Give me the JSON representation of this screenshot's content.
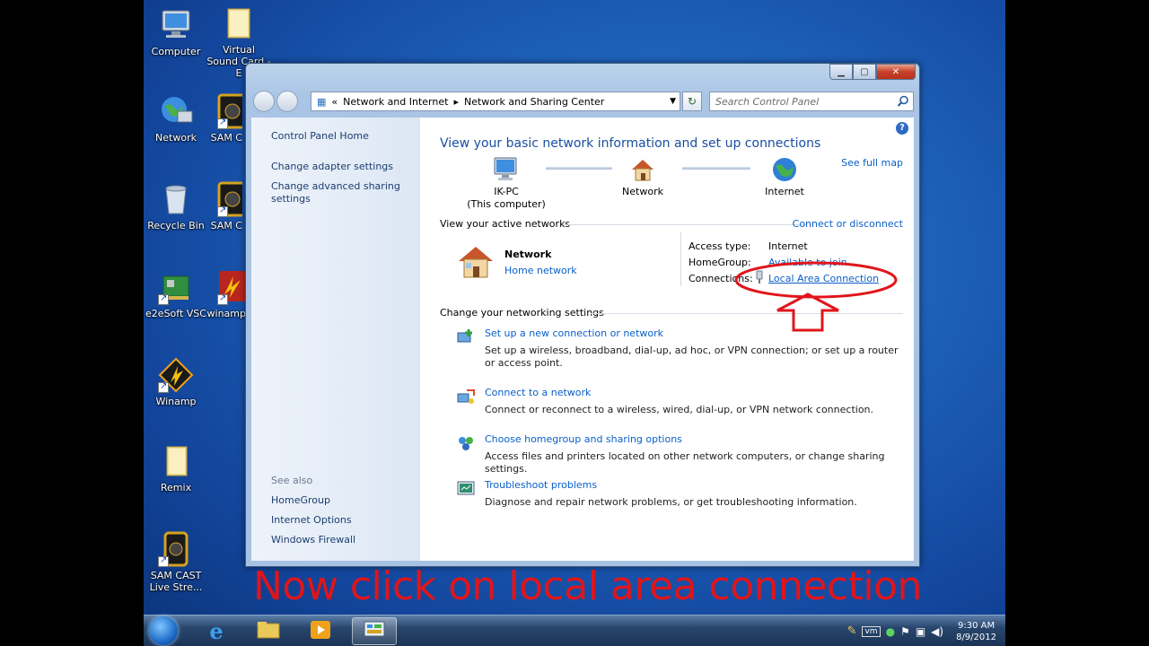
{
  "desktop": {
    "icons": [
      {
        "label": "Computer",
        "name": "computer"
      },
      {
        "label": "Virtual Sound Card - E",
        "name": "virtual-sound-card"
      },
      {
        "label": "Network",
        "name": "network"
      },
      {
        "label": "SAM C",
        "name": "sam-c-1"
      },
      {
        "label": "Recycle Bin",
        "name": "recycle-bin"
      },
      {
        "label": "SAM C",
        "name": "sam-c-2"
      },
      {
        "label": "e2eSoft VSC",
        "name": "e2esoft-vsc"
      },
      {
        "label": "winamp",
        "name": "winamp-shortcut"
      },
      {
        "label": "Winamp",
        "name": "winamp"
      },
      {
        "label": "Remix",
        "name": "remix"
      },
      {
        "label": "SAM CAST Live Stre...",
        "name": "sam-cast"
      }
    ]
  },
  "window": {
    "address": {
      "prefix": "«",
      "crumb1": "Network and Internet",
      "crumb2": "Network and Sharing Center"
    },
    "search": {
      "placeholder": "Search Control Panel"
    },
    "nav": {
      "home": "Control Panel Home",
      "adapter": "Change adapter settings",
      "advanced": "Change advanced sharing settings",
      "see_also": "See also",
      "homegroup": "HomeGroup",
      "internet_options": "Internet Options",
      "firewall": "Windows Firewall"
    },
    "main": {
      "heading": "View your basic network information and set up connections",
      "see_full_map": "See full map",
      "map": {
        "pc_name": "IK-PC",
        "pc_sub": "(This computer)",
        "network": "Network",
        "internet": "Internet"
      },
      "active_header": "View your active networks",
      "connect_disconnect": "Connect or disconnect",
      "active": {
        "name": "Network",
        "type": "Home network",
        "access_type_label": "Access type:",
        "access_type_value": "Internet",
        "homegroup_label": "HomeGroup:",
        "homegroup_value": "Available to join",
        "connections_label": "Connections:",
        "connections_value": "Local Area Connection"
      },
      "settings_header": "Change your networking settings",
      "tasks": [
        {
          "title": "Set up a new connection or network",
          "desc": "Set up a wireless, broadband, dial-up, ad hoc, or VPN connection; or set up a router or access point."
        },
        {
          "title": "Connect to a network",
          "desc": "Connect or reconnect to a wireless, wired, dial-up, or VPN network connection."
        },
        {
          "title": "Choose homegroup and sharing options",
          "desc": "Access files and printers located on other network computers, or change sharing settings."
        },
        {
          "title": "Troubleshoot problems",
          "desc": "Diagnose and repair network problems, or get troubleshooting information."
        }
      ]
    }
  },
  "annotation": {
    "caption": "Now click on local area connection",
    "color": "#e0151b"
  },
  "taskbar": {
    "clock_time": "9:30 AM",
    "clock_date": "8/9/2012"
  }
}
